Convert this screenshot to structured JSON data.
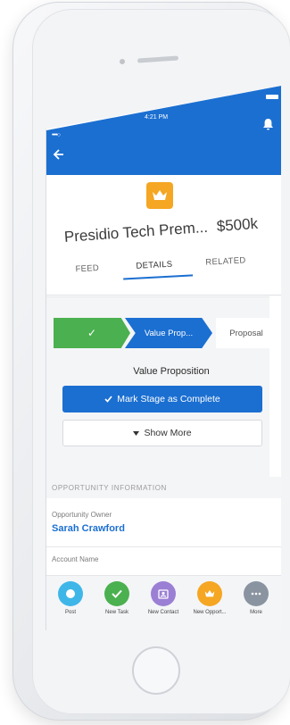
{
  "status_bar": {
    "signal": "••••○",
    "time": "4:21 PM"
  },
  "header": {
    "back_icon": "arrow-left-icon",
    "notification_icon": "bell-icon"
  },
  "record": {
    "icon": "crown-icon",
    "title": "Presidio Tech Prem...",
    "amount": "$500k"
  },
  "tabs": [
    {
      "label": "FEED",
      "selected": false
    },
    {
      "label": "DETAILS",
      "selected": true
    },
    {
      "label": "RELATED",
      "selected": false
    }
  ],
  "path": {
    "steps": [
      {
        "label": "✓",
        "state": "complete"
      },
      {
        "label": "Value Prop...",
        "state": "current"
      },
      {
        "label": "Proposal",
        "state": "upcoming"
      }
    ],
    "current_stage": "Value Proposition",
    "mark_complete_label": "Mark Stage as Complete",
    "show_more_label": "Show More"
  },
  "info": {
    "section_title": "OPPORTUNITY INFORMATION",
    "owner_label": "Opportunity Owner",
    "owner_value": "Sarah Crawford",
    "account_label": "Account Name"
  },
  "actions": [
    {
      "label": "Post",
      "color": "#3fb6e8",
      "icon": "post-icon"
    },
    {
      "label": "New Task",
      "color": "#4bb04f",
      "icon": "checkmark-icon"
    },
    {
      "label": "New Contact",
      "color": "#9b7fd4",
      "icon": "contact-icon"
    },
    {
      "label": "New Opport...",
      "color": "#f5a623",
      "icon": "crown-icon"
    },
    {
      "label": "More",
      "color": "#8a94a0",
      "icon": "more-icon"
    }
  ],
  "colors": {
    "brand": "#1b6fd1",
    "success": "#4bb04f",
    "opportunity": "#f5a623"
  }
}
